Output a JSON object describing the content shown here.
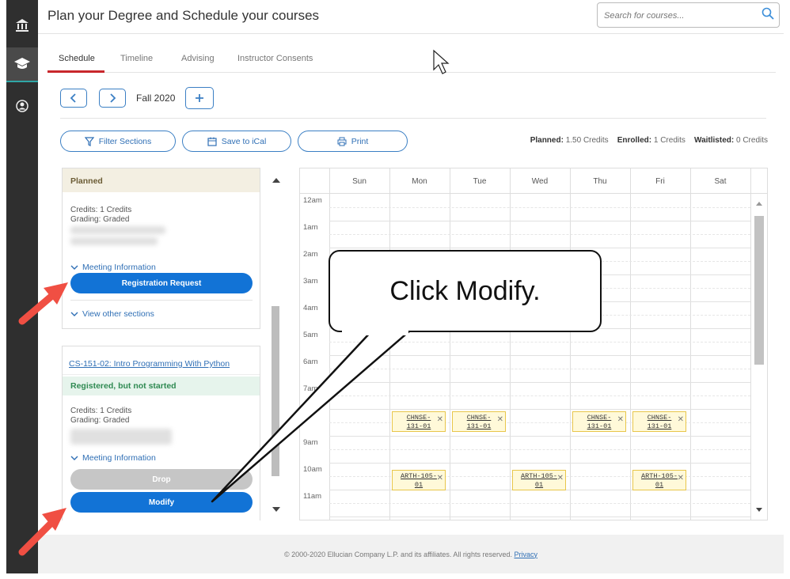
{
  "header": {
    "title": "Plan your Degree and Schedule your courses",
    "search_placeholder": "Search for courses..."
  },
  "tabs": [
    {
      "label": "Schedule",
      "active": true
    },
    {
      "label": "Timeline",
      "active": false
    },
    {
      "label": "Advising",
      "active": false
    },
    {
      "label": "Instructor Consents",
      "active": false
    }
  ],
  "term": {
    "label": "Fall 2020",
    "prev": "<",
    "next": ">",
    "add": "+"
  },
  "actions": {
    "filter": "Filter Sections",
    "ical": "Save to iCal",
    "print": "Print"
  },
  "credits": {
    "planned_label": "Planned:",
    "planned_value": "1.50 Credits",
    "enrolled_label": "Enrolled:",
    "enrolled_value": "1 Credits",
    "waitlisted_label": "Waitlisted:",
    "waitlisted_value": "0 Credits"
  },
  "card1": {
    "status": "Planned",
    "credits": "Credits: 1 Credits",
    "grading": "Grading: Graded",
    "meeting": "Meeting Information",
    "button": "Registration Request",
    "other": "View other sections"
  },
  "card2": {
    "course": "CS-151-02: Intro Programming With Python",
    "status": "Registered, but not started",
    "credits": "Credits: 1 Credits",
    "grading": "Grading: Graded",
    "meeting": "Meeting Information",
    "drop": "Drop",
    "modify": "Modify"
  },
  "calendar": {
    "days": [
      "Sun",
      "Mon",
      "Tue",
      "Wed",
      "Thu",
      "Fri",
      "Sat"
    ],
    "times": [
      "12am",
      "1am",
      "2am",
      "3am",
      "4am",
      "5am",
      "6am",
      "7am",
      "",
      "9am",
      "10am",
      "11am"
    ],
    "events": [
      {
        "l1": "CHNSE-",
        "l2": "131-01"
      },
      {
        "l1": "CHNSE-",
        "l2": "131-01"
      },
      {
        "l1": "CHNSE-",
        "l2": "131-01"
      },
      {
        "l1": "CHNSE-",
        "l2": "131-01"
      },
      {
        "l1": "ARTH-105-",
        "l2": "01"
      },
      {
        "l1": "ARTH-105-",
        "l2": "01"
      },
      {
        "l1": "ARTH-105-",
        "l2": "01"
      }
    ]
  },
  "callout": {
    "text": "Click Modify."
  },
  "footer": {
    "text": "© 2000-2020 Ellucian Company L.P. and its affiliates. All rights reserved.",
    "privacy": "Privacy"
  },
  "colors": {
    "primary": "#1273d6",
    "accent_red": "#c8272c",
    "arrow": "#f04f43"
  }
}
